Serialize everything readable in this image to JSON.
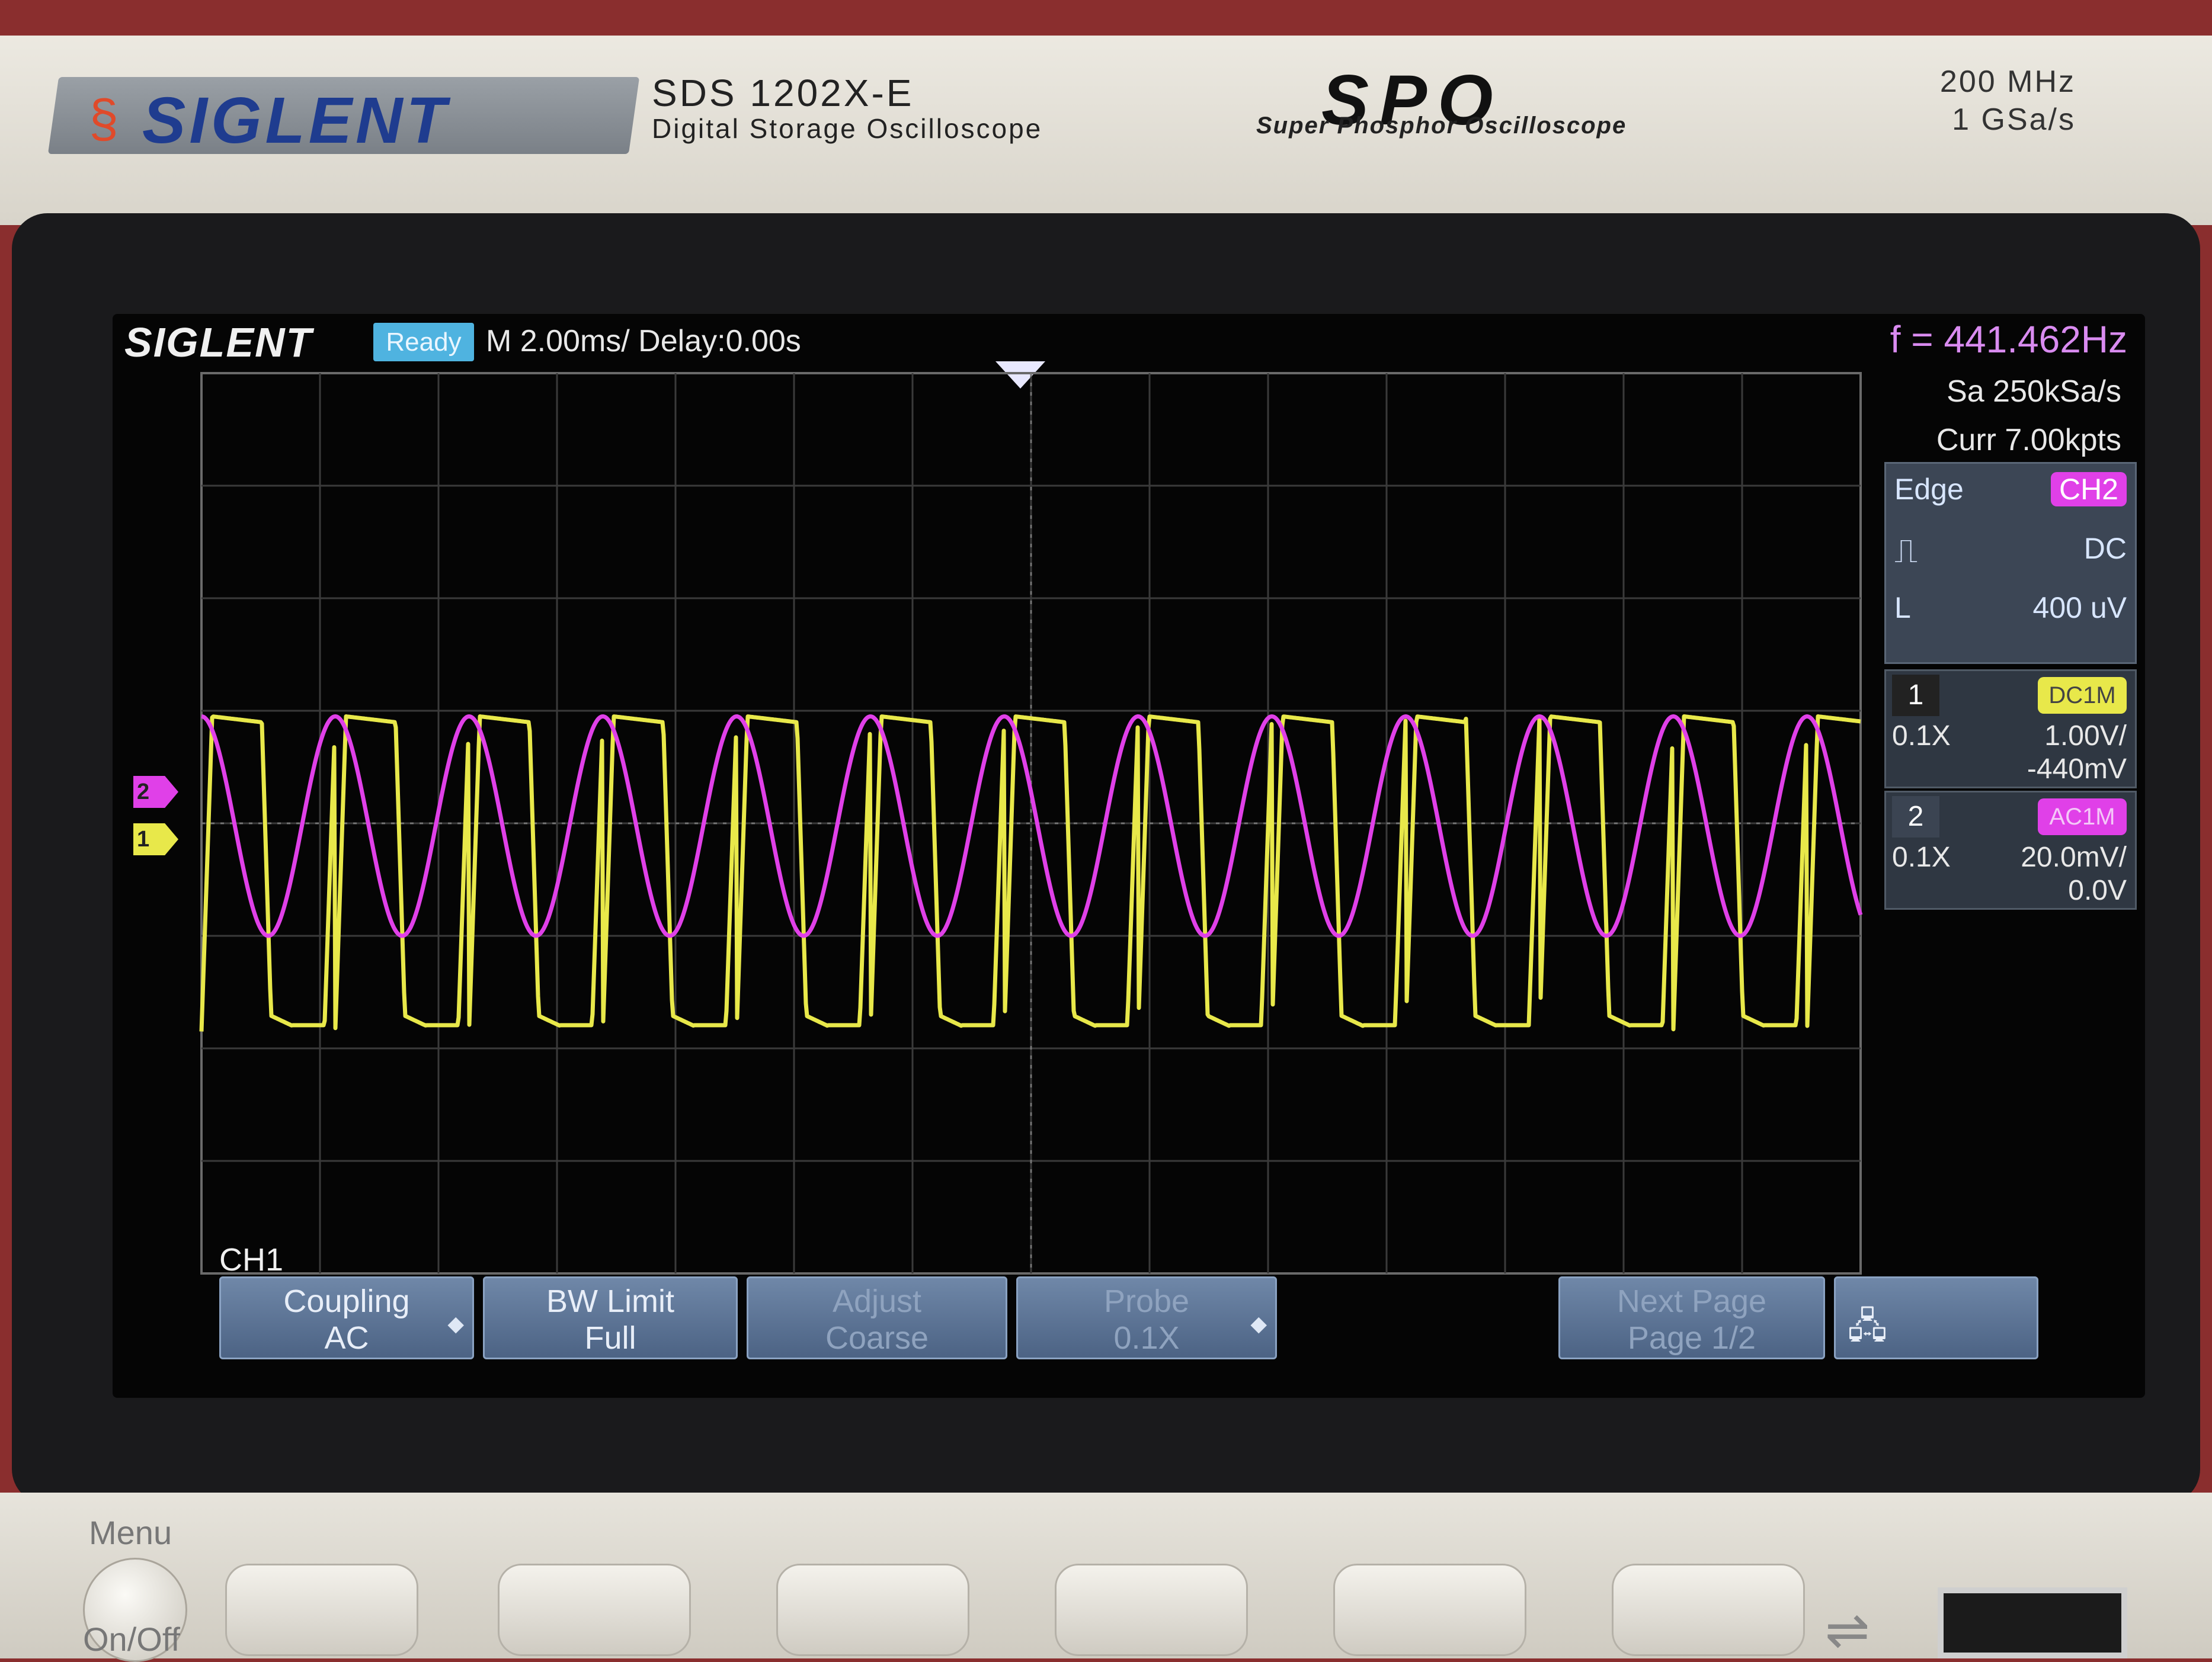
{
  "bezel": {
    "brand": "SIGLENT",
    "model": "SDS 1202X-E",
    "model_desc": "Digital Storage Oscilloscope",
    "spo_logo": "SPO",
    "spo_desc": "Super Phosphor Oscilloscope",
    "spec_bandwidth": "200 MHz",
    "spec_sample_rate": "1 GSa/s"
  },
  "screen": {
    "brand": "SIGLENT",
    "run_state": "Ready",
    "timebase": "M 2.00ms/ Delay:0.00s",
    "frequency": "f = 441.462Hz",
    "sample_rate": "Sa 250kSa/s",
    "memory_depth": "Curr 7.00kpts",
    "trigger": {
      "type": "Edge",
      "source": "CH2",
      "coupling": "DC",
      "level_label": "L",
      "level": "400 uV"
    },
    "channels": [
      {
        "num": "1",
        "coupling_tag": "DC1M",
        "probe": "0.1X",
        "scale": "1.00V/",
        "offset": "-440mV",
        "color": "#e8e84a"
      },
      {
        "num": "2",
        "coupling_tag": "AC1M",
        "probe": "0.1X",
        "scale": "20.0mV/",
        "offset": "0.0V",
        "color": "#e040e8"
      }
    ],
    "active_menu": "CH1",
    "softkeys": [
      {
        "line1": "Coupling",
        "line2": "AC"
      },
      {
        "line1": "BW Limit",
        "line2": "Full"
      },
      {
        "line1": "Adjust",
        "line2": "Coarse"
      },
      {
        "line1": "Probe",
        "line2": "0.1X"
      },
      {
        "line1": "Next Page",
        "line2": "Page 1/2"
      }
    ]
  },
  "panel": {
    "menu_label": "Menu",
    "onoff_label": "On/Off"
  },
  "chart_data": {
    "type": "line",
    "xlabel": "",
    "ylabel": "",
    "grid": true,
    "x_divisions": 14,
    "y_divisions": 8,
    "series": [
      {
        "name": "1",
        "color": "#e8e84a",
        "shape": "square-like",
        "high_div": 0.95,
        "low_div": -1.85,
        "cycles": 12.4,
        "phase": 0.0
      },
      {
        "name": "2",
        "color": "#e040e8",
        "shape": "sine",
        "high_div": 0.95,
        "low_div": -1.0,
        "cycles": 12.4,
        "phase": 0.25
      }
    ]
  }
}
